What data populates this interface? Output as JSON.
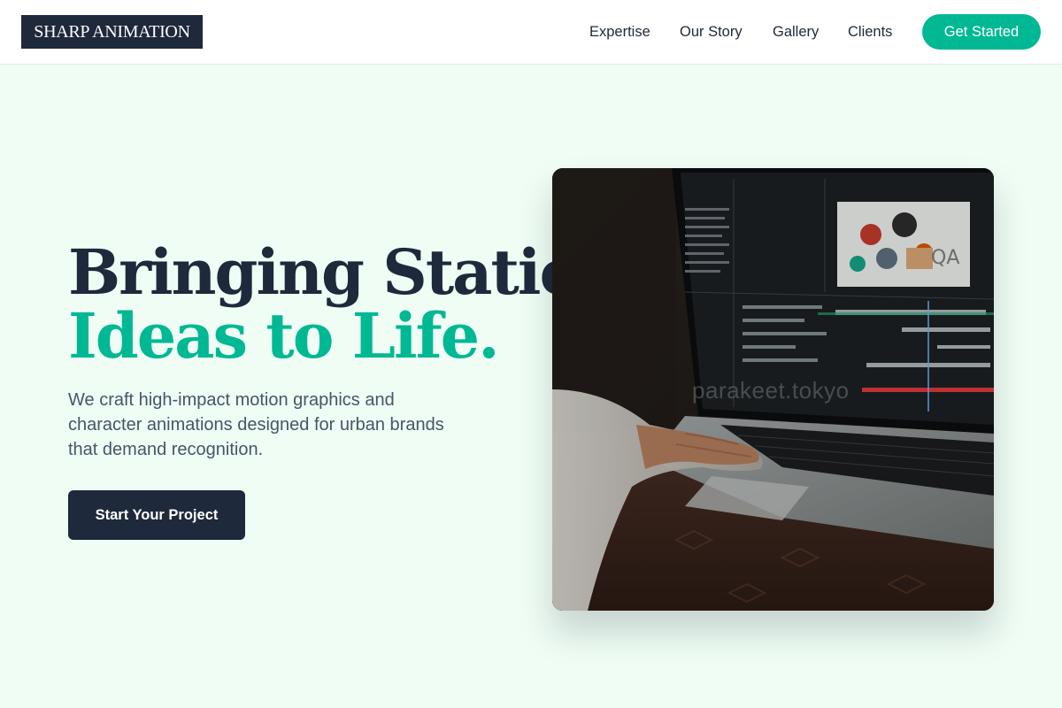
{
  "header": {
    "logo": "SHARP ANIMATION",
    "nav": [
      "Expertise",
      "Our Story",
      "Gallery",
      "Clients"
    ],
    "cta": "Get Started"
  },
  "hero": {
    "title_line1": "Bringing Static",
    "title_line2": "Ideas to Life.",
    "description": "We craft high-impact motion graphics and character animations designed for urban brands that demand recognition.",
    "cta": "Start Your Project",
    "image_watermark": "parakeet.tokyo"
  },
  "colors": {
    "accent": "#00b894",
    "dark": "#1e293b",
    "background": "#effdf4"
  }
}
